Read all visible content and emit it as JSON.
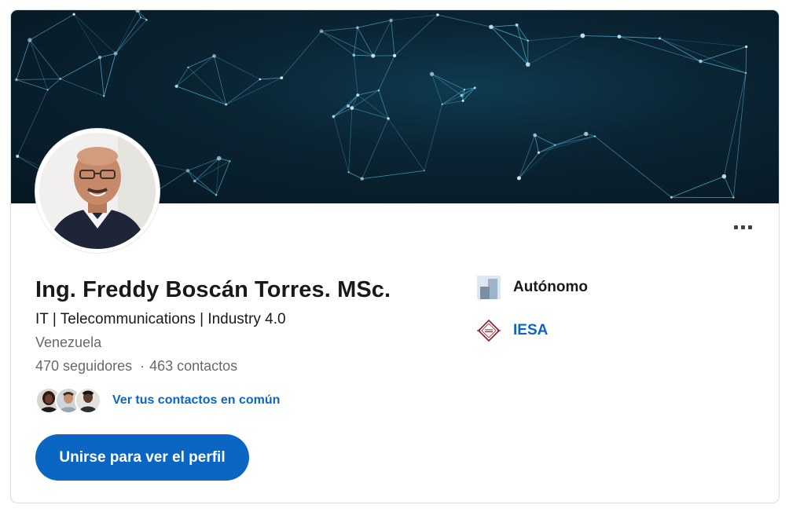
{
  "profile": {
    "name": "Ing. Freddy Boscán Torres. MSc.",
    "headline": "IT | Telecommunications | Industry 4.0",
    "location": "Venezuela",
    "followers": "470 seguidores",
    "separator": "·",
    "connections": "463 contactos",
    "mutual_link": "Ver tus contactos en común",
    "join_button": "Unirse para ver el perfil"
  },
  "experience": [
    {
      "label": "Autónomo",
      "icon": "company-placeholder-icon"
    },
    {
      "label": "IESA",
      "icon": "iesa-logo"
    }
  ],
  "colors": {
    "accent": "#0a66c2",
    "banner_dark": "#061722",
    "banner_mid": "#0f3a4f",
    "network_line": "#4fb3d9"
  }
}
